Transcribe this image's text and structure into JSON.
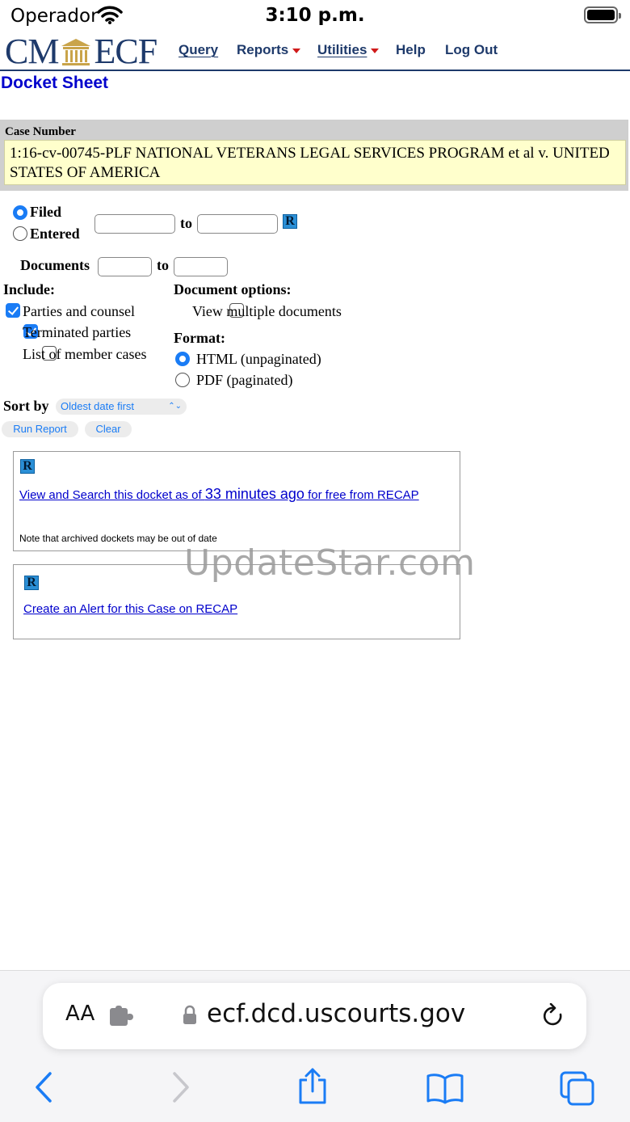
{
  "status_bar": {
    "carrier": "Operador",
    "time": "3:10 p.m."
  },
  "header": {
    "logo_left": "CM",
    "logo_right": "ECF",
    "nav": [
      {
        "label": "Query",
        "dropdown": false
      },
      {
        "label": "Reports",
        "dropdown": true
      },
      {
        "label": "Utilities",
        "dropdown": true
      },
      {
        "label": "Help",
        "dropdown": false
      },
      {
        "label": "Log Out",
        "dropdown": false
      }
    ]
  },
  "page_title": "Docket Sheet",
  "case": {
    "label": "Case Number",
    "value": "1:16-cv-00745-PLF NATIONAL VETERANS LEGAL SERVICES PROGRAM et al v. UNITED STATES OF AMERICA"
  },
  "date_filter": {
    "filed_label": "Filed",
    "entered_label": "Entered",
    "selected": "Filed",
    "from_value": "",
    "to_label": "to",
    "to_value": "",
    "recap_badge": "R"
  },
  "documents": {
    "label": "Documents",
    "from_value": "",
    "to_label": "to",
    "to_value": ""
  },
  "include": {
    "heading": "Include:",
    "options": [
      {
        "label": "Parties and counsel",
        "checked": true
      },
      {
        "label": "Terminated parties",
        "checked": true
      },
      {
        "label": "List of member cases",
        "checked": false
      }
    ]
  },
  "document_options": {
    "heading": "Document options:",
    "view_multiple_label": "View multiple documents",
    "view_multiple_checked": false
  },
  "format": {
    "heading": "Format:",
    "options": [
      {
        "label": "HTML (unpaginated)",
        "selected": true
      },
      {
        "label": "PDF (paginated)",
        "selected": false
      }
    ]
  },
  "sort": {
    "label": "Sort by",
    "selected": "Oldest date first"
  },
  "buttons": {
    "run_report": "Run Report",
    "clear": "Clear"
  },
  "recap_view": {
    "badge": "R",
    "link_prefix": "View and Search this docket as of ",
    "link_age": "33 minutes ago",
    "link_suffix": " for free from RECAP",
    "note": "Note that archived dockets may be out of date"
  },
  "recap_alert": {
    "badge": "R",
    "link": "Create an Alert for this Case on RECAP"
  },
  "watermark": "UpdateStar.com",
  "browser": {
    "text_size": "AA",
    "url": "ecf.dcd.uscourts.gov"
  },
  "colors": {
    "accent": "#1a7cf5",
    "link": "#0000cc",
    "header_navy": "#1e3a6b",
    "case_bg": "#ffffcc",
    "recap_badge": "#2b8fd6"
  }
}
